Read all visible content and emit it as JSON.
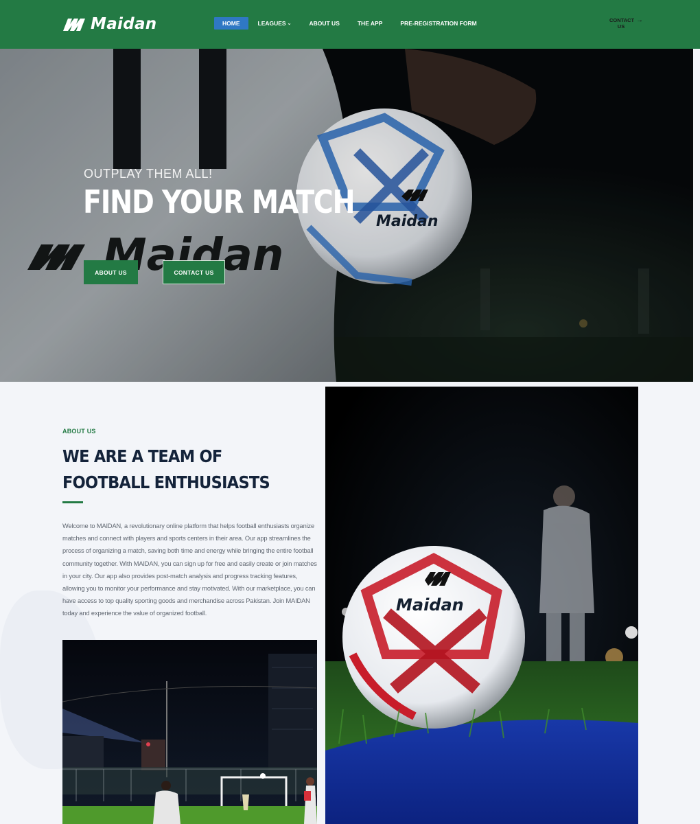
{
  "header": {
    "logo_text": "Maidan",
    "nav": [
      {
        "label": "HOME",
        "active": true
      },
      {
        "label": "LEAGUES",
        "has_dropdown": true
      },
      {
        "label": "ABOUT US"
      },
      {
        "label": "THE APP"
      },
      {
        "label": "PRE-REGISTRATION FORM"
      }
    ],
    "contact_label": "CONTACT US",
    "contact_icon": "arrow-right-icon"
  },
  "hero": {
    "tagline": "OUTPLAY THEM ALL!",
    "title": "FIND YOUR MATCH",
    "about_button": "ABOUT US",
    "contact_button": "CONTACT US",
    "jersey_text": "Maidan",
    "ball_brand": "Maidan"
  },
  "about": {
    "kicker": "ABOUT US",
    "title": "WE ARE A TEAM OF FOOTBALL ENTHUSIASTS",
    "body": "Welcome to MAIDAN, a revolutionary online platform that helps football enthusiasts organize matches and connect with players and sports centers in their area. Our app streamlines the process of organizing a match, saving both time and energy while bringing the entire football community together. With MAIDAN, you can sign up for free and easily create or join matches in your city. Our app also provides post-match analysis and progress tracking features, allowing you to monitor your performance and stay motivated. With our marketplace, you can have access to top quality sporting goods and merchandise across Pakistan. Join MAIDAN today and experience the value of organized football.",
    "ball_brand": "Maidan"
  },
  "colors": {
    "brand_green": "#237a44",
    "nav_active": "#2f78c4",
    "heading_navy": "#14233a"
  }
}
